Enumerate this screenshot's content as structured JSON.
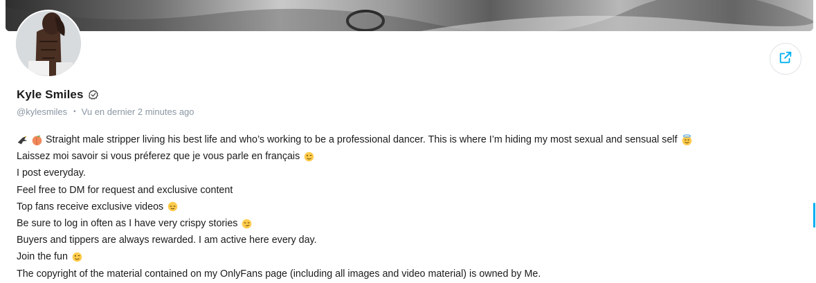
{
  "profile": {
    "name": "Kyle Smiles",
    "handle": "@kylesmiles",
    "last_seen": "Vu en dernier 2 minutes ago",
    "separator": "•"
  },
  "bio": {
    "line1": "Straight male stripper living his best life and who’s working to be a professional dancer. This is where I’m hiding my most sexual and sensual self",
    "line2": "Laissez moi savoir si vous préferez que je vous parle en français",
    "line3": "I post everyday.",
    "line4": "Feel free to DM for request and exclusive content",
    "line5": "Top fans receive exclusive videos",
    "line6": "Be sure to log in often as I have very crispy stories",
    "line7": "Buyers and tippers are always rewarded. I am active here every day.",
    "line8": "Join the fun",
    "line9": "The copyright of the material contained on my OnlyFans page (including all images and video material) is owned by Me."
  },
  "icons": {
    "share": "share-icon",
    "verified": "verified-icon",
    "lead_emojis": [
      "eagle-emoji",
      "peach-emoji"
    ]
  },
  "colors": {
    "accent": "#00aff0",
    "muted_text": "#8a96a3",
    "text": "#1a1a1a"
  }
}
